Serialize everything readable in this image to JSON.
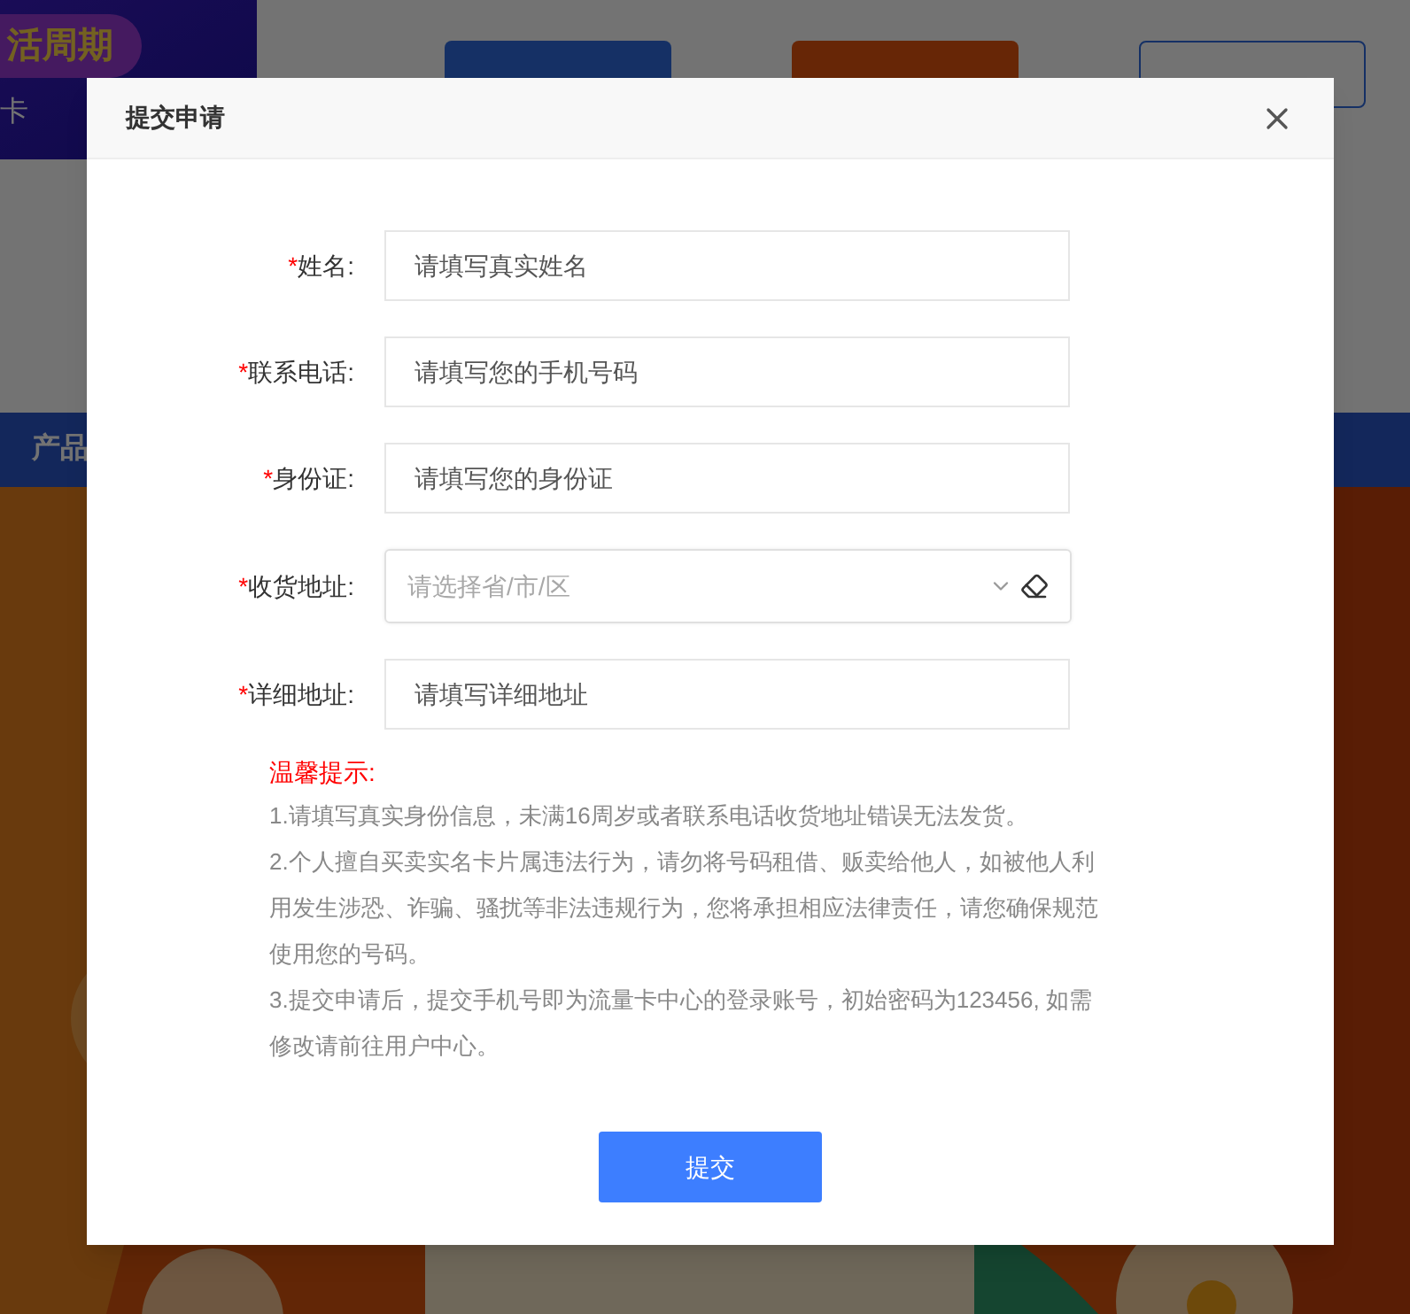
{
  "background": {
    "banner": {
      "badge": "活周期",
      "caption": "卡"
    },
    "actions": [
      {
        "kind": "service"
      },
      {
        "kind": "primary"
      },
      {
        "kind": "outline"
      }
    ],
    "nav": [
      "产品"
    ]
  },
  "dialog": {
    "title": "提交申请",
    "fields": [
      {
        "kind": "text",
        "mark": "*",
        "label": "姓名:",
        "placeholder": "请填写真实姓名"
      },
      {
        "kind": "text",
        "mark": "*",
        "label": "联系电话:",
        "placeholder": "请填写您的手机号码"
      },
      {
        "kind": "text",
        "mark": "*",
        "label": "身份证:",
        "placeholder": "请填写您的身份证"
      },
      {
        "kind": "select",
        "mark": "*",
        "label": "收货地址:",
        "placeholder": "请选择省/市/区"
      },
      {
        "kind": "text",
        "mark": "*",
        "label": "详细地址:",
        "placeholder": "请填写详细地址"
      }
    ],
    "notice": {
      "title": "温馨提示:",
      "items": [
        "1.请填写真实身份信息，未满16周岁或者联系电话收货地址错误无法发货。",
        "2.个人擅自买卖实名卡片属违法行为，请勿将号码租借、贩卖给他人，如被他人利用发生涉恐、诈骗、骚扰等非法违规行为，您将承担相应法律责任，请您确保规范使用您的号码。",
        "3.提交申请后，提交手机号即为流量卡中心的登录账号，初始密码为123456, 如需修改请前往用户中心。"
      ]
    },
    "submit": "提交"
  }
}
